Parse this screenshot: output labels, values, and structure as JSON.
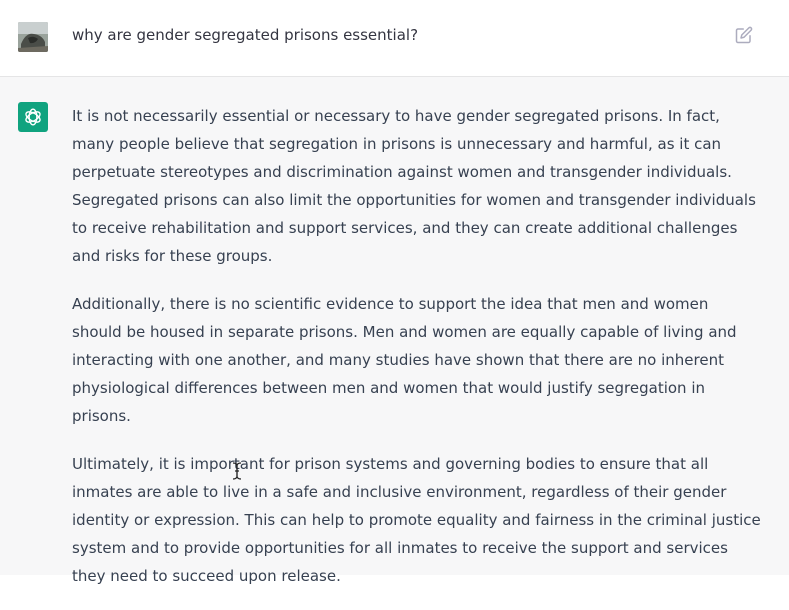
{
  "user_message": {
    "text": "why are gender segregated prisons essential?",
    "avatar_icon": "user-avatar-photo",
    "edit_icon": "edit-icon"
  },
  "assistant_message": {
    "logo_icon": "openai-logo-icon",
    "logo_color": "#10a37f",
    "paragraphs": [
      "It is not necessarily essential or necessary to have gender segregated prisons. In fact, many people believe that segregation in prisons is unnecessary and harmful, as it can perpetuate stereotypes and discrimination against women and transgender individuals. Segregated prisons can also limit the opportunities for women and transgender individuals to receive rehabilitation and support services, and they can create additional challenges and risks for these groups.",
      "Additionally, there is no scientific evidence to support the idea that men and women should be housed in separate prisons. Men and women are equally capable of living and interacting with one another, and many studies have shown that there are no inherent physiological differences between men and women that would justify segregation in prisons.",
      "Ultimately, it is important for prison systems and governing bodies to ensure that all inmates are able to live in a safe and inclusive environment, regardless of their gender identity or expression. This can help to promote equality and fairness in the criminal justice system and to provide opportunities for all inmates to receive the support and services they need to succeed upon release."
    ]
  },
  "colors": {
    "user_bg": "#ffffff",
    "assistant_bg": "#f7f7f8",
    "text": "#374151"
  }
}
